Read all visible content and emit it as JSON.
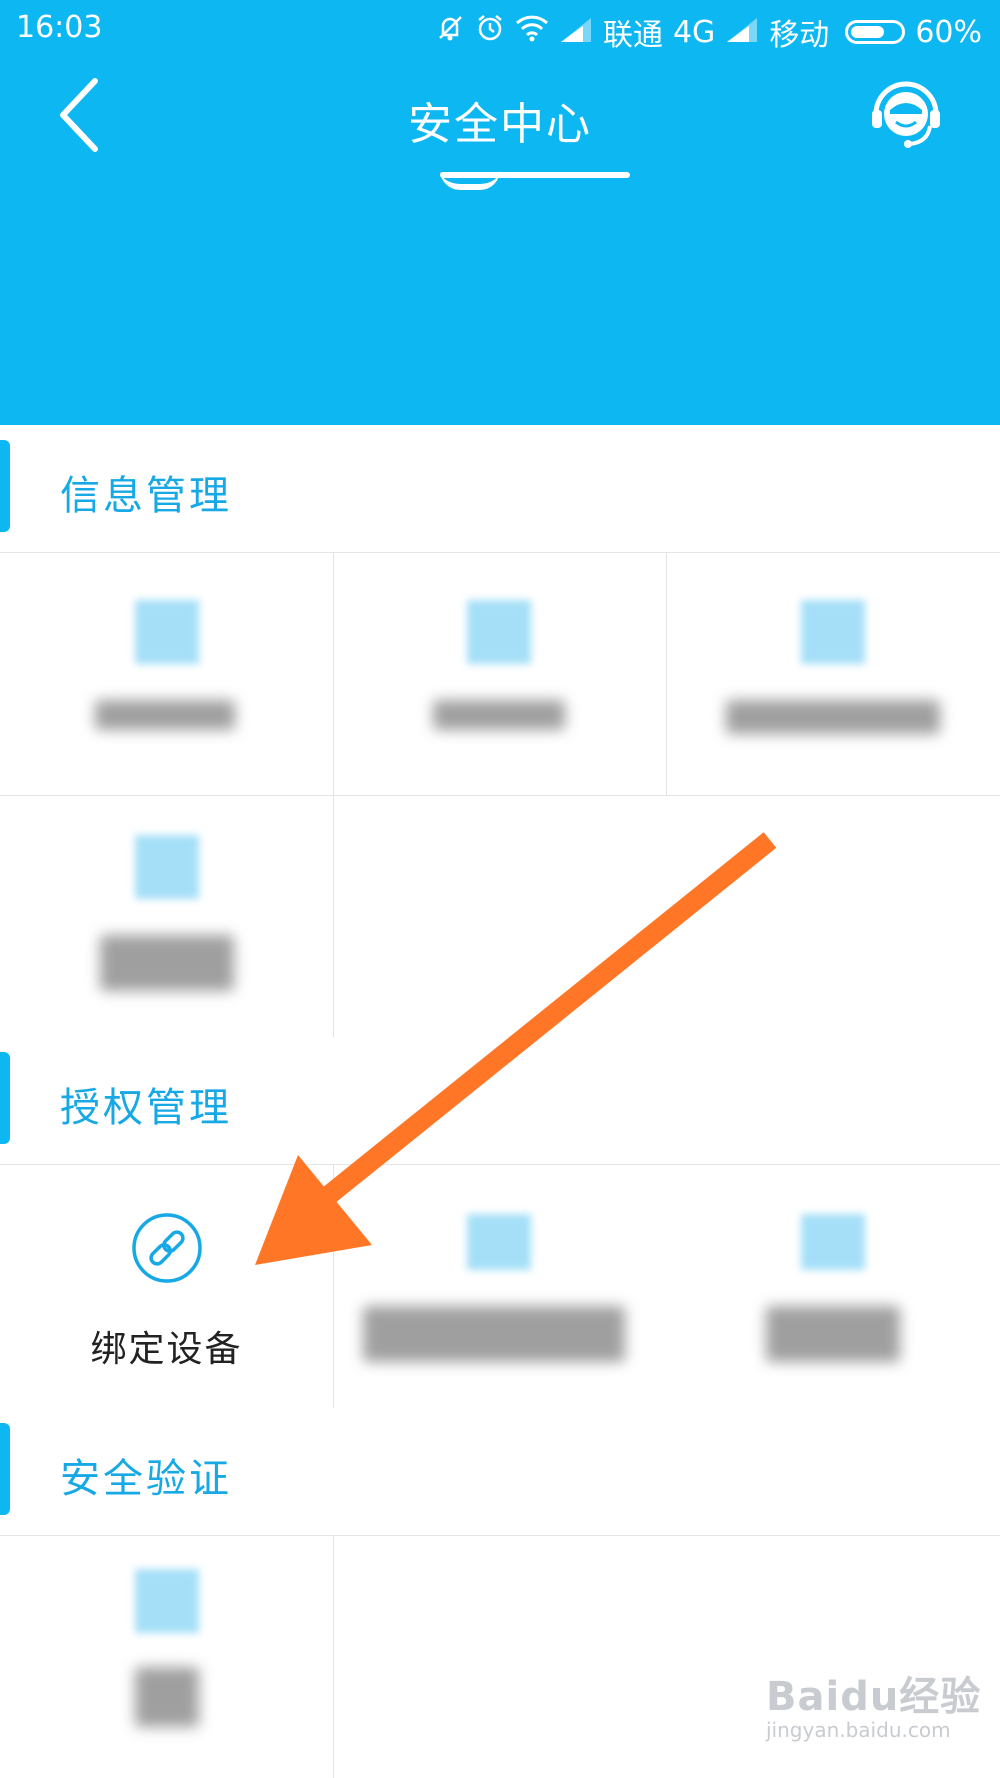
{
  "status_bar": {
    "time": "16:03",
    "carrier1": "联通",
    "network1": "4G",
    "carrier2": "移动",
    "battery_text": "60%",
    "battery_level": 0.6,
    "icons": [
      "mute-icon",
      "alarm-icon",
      "wifi-icon",
      "signal-icon",
      "signal-icon",
      "battery-icon"
    ]
  },
  "header": {
    "title": "安全中心",
    "back_icon": "chevron-left-icon",
    "service_icon": "customer-service-icon",
    "background_color": "#0db7f1"
  },
  "sections": [
    {
      "label": "信息管理"
    },
    {
      "label": "授权管理"
    },
    {
      "label": "安全验证"
    }
  ],
  "auth_items": [
    {
      "label": "绑定设备",
      "icon": "link-icon"
    }
  ],
  "colors": {
    "accent": "#0db7f1",
    "section_label": "#17a8e6",
    "arrow": "#ff7726"
  },
  "watermark": {
    "logo_text": "Baidu经验",
    "url": "jingyan.baidu.com"
  }
}
